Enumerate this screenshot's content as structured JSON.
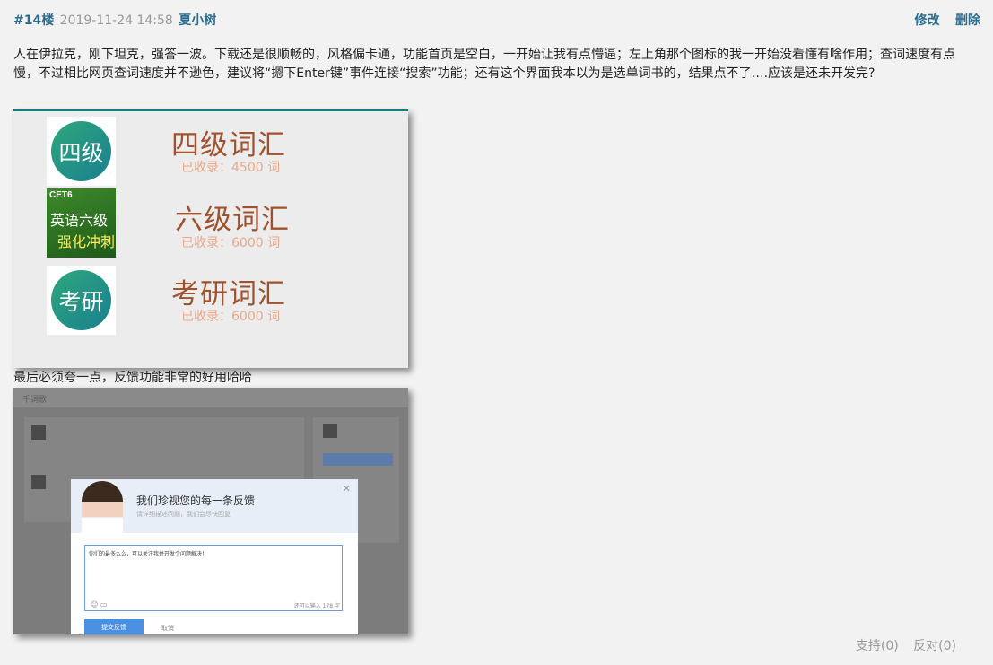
{
  "post": {
    "floor": "#14楼",
    "date": "2019-11-24 14:58",
    "author": "夏小树",
    "edit_label": "修改",
    "delete_label": "删除",
    "body": "人在伊拉克，刚下坦克，强答一波。下载还是很顺畅的，风格偏卡通，功能首页是空白，一开始让我有点懵逼；左上角那个图标的我一开始没看懂有啥作用；查词速度有点慢，不过相比网页查词速度并不逊色，建议将“摁下Enter键”事件连接“搜索”功能；还有这个界面我本以为是选单词书的，结果点不了….应该是还未开发完?",
    "caption": "最后必须夸一点，反馈功能非常的好用哈哈",
    "support_label": "支持(0)",
    "oppose_label": "反对(0)"
  },
  "wordbooks": [
    {
      "badge": "四级",
      "title": "四级词汇",
      "count": "已收录：4500 词"
    },
    {
      "badge_tag": "CET6",
      "badge_line1": "英语六级",
      "badge_line2": "强化冲刺",
      "title": "六级词汇",
      "count": "已收录：6000 词"
    },
    {
      "badge": "考研",
      "title": "考研词汇",
      "count": "已收录：6000 词"
    }
  ],
  "feedback_dialog": {
    "app_name": "千词歌",
    "title": "我们珍视您的每一条反馈",
    "subtitle": "请详细描述问题，我们会尽快回复",
    "text": "你们的最多么么，可以关注我并开发个问题解决！",
    "limit": "还可以输入 178 字",
    "submit_label": "提交反馈",
    "cancel_label": "取消",
    "close_icon": "close-icon"
  },
  "colors": {
    "link": "#2b6d8f",
    "accent_line": "#0e7f7c",
    "title_brown": "#a0522d",
    "count_peach": "#e8a98a"
  }
}
